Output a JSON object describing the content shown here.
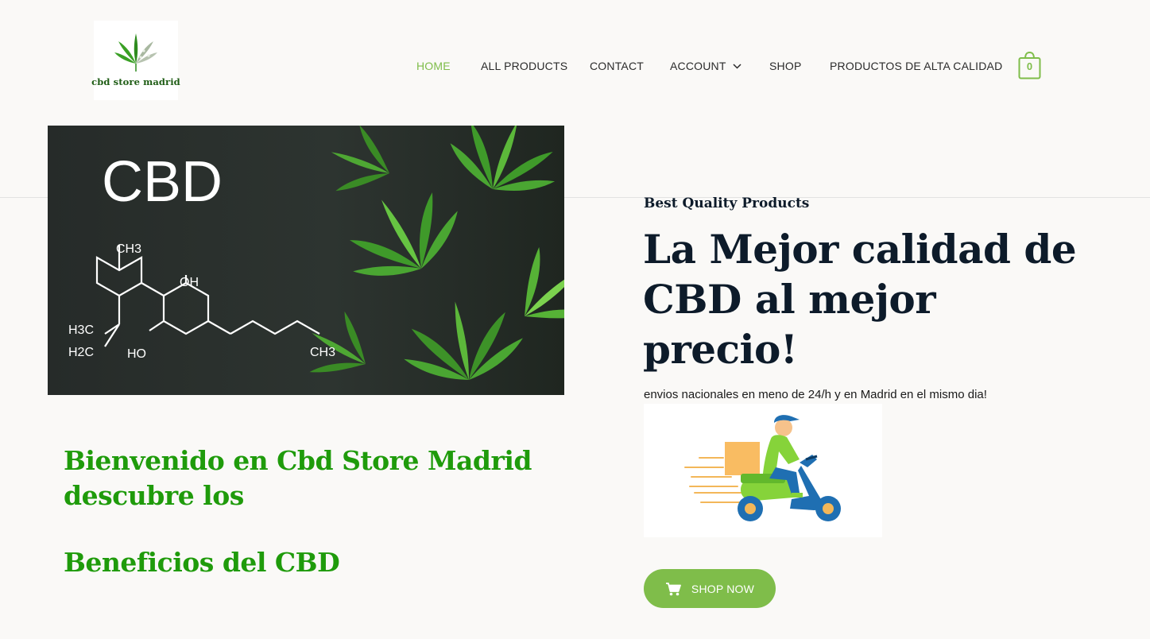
{
  "header": {
    "logo_text": "cbd store madrid",
    "nav": [
      {
        "label": "HOME",
        "active": true
      },
      {
        "label": "ALL PRODUCTS"
      },
      {
        "label": "CONTACT"
      },
      {
        "label": "ACCOUNT",
        "has_dropdown": true
      },
      {
        "label": "SHOP"
      },
      {
        "label": "PRODUCTOS DE ALTA CALIDAD"
      }
    ],
    "cart_count": "0"
  },
  "hero_image": {
    "title_text": "CBD",
    "molecule_labels": [
      "CH3",
      "OH",
      "HO",
      "H3C",
      "H2C",
      "CH3"
    ]
  },
  "welcome": {
    "line1": "Bienvenido en Cbd Store Madrid",
    "line2": "descubre los",
    "benefits": "Beneficios del CBD"
  },
  "promo": {
    "eyebrow": "Best Quality Products",
    "headline": "La Mejor calidad de CBD al mejor precio!",
    "subtext": "envios nacionales en meno de 24/h y en Madrid en el mismo dia!",
    "button_label": "SHOP NOW",
    "button_icon": "cart-icon"
  },
  "colors": {
    "accent": "#7fbd4a",
    "heading_green": "#1f9b0b",
    "navy": "#0d1b2a",
    "background": "#faf9f7"
  }
}
